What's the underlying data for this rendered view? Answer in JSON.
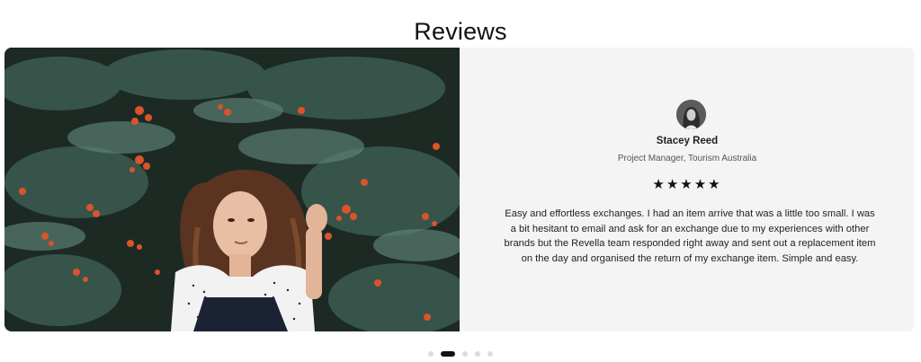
{
  "section": {
    "title": "Reviews"
  },
  "review": {
    "name": "Stacey Reed",
    "role": "Project Manager, Tourism Australia",
    "rating": 5,
    "stars": "★★★★★",
    "text": "Easy and effortless exchanges. I had an item arrive that was a little too small. I was a bit hesitant to email and ask for an exchange due to my experiences with other brands but the Revella team responded right away and sent out a replacement item on the day and organised the return of my exchange item. Simple and easy."
  },
  "carousel": {
    "total_slides": 5,
    "active_index": 1
  },
  "colors": {
    "review_bg": "#f4f4f4",
    "text": "#222222",
    "active_dot": "#111111",
    "inactive_dot": "#dcdcdc"
  }
}
